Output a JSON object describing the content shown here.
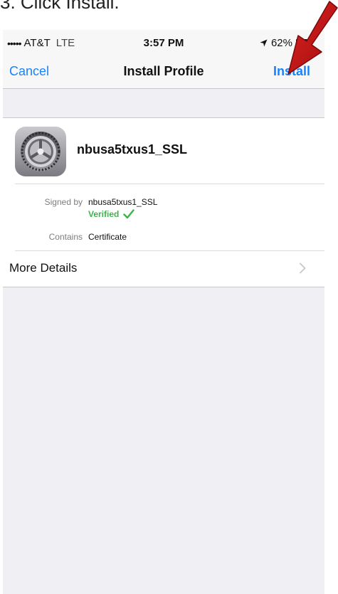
{
  "caption": "3. Click Install.",
  "status_bar": {
    "signal": "•••••",
    "carrier": "AT&T",
    "network": "LTE",
    "time": "3:57 PM",
    "battery": "62%"
  },
  "nav": {
    "cancel_label": "Cancel",
    "title": "Install Profile",
    "install_label": "Install"
  },
  "profile": {
    "name": "nbusa5txus1_SSL",
    "signed_by_label": "Signed by",
    "signed_by_value": "nbusa5txus1_SSL",
    "verified_label": "Verified",
    "contains_label": "Contains",
    "contains_value": "Certificate",
    "more_details_label": "More Details",
    "icon": "settings-gear-icon"
  },
  "colors": {
    "accent_blue": "#1a82fb",
    "verified_green": "#3ab54a",
    "arrow_red": "#c01818",
    "group_background": "#efeff4"
  }
}
